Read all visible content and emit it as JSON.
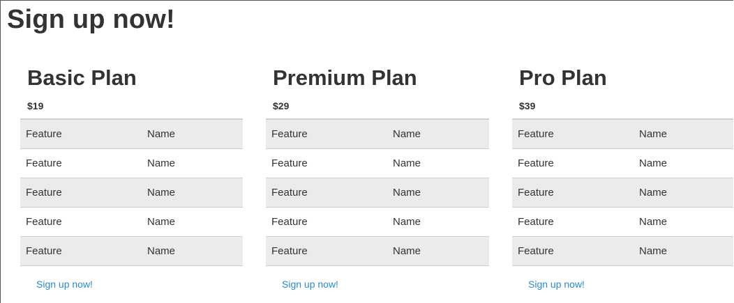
{
  "page": {
    "title": "Sign up now!"
  },
  "plans": [
    {
      "name": "Basic Plan",
      "price": "$19",
      "features": [
        {
          "label": "Feature",
          "value": "Name"
        },
        {
          "label": "Feature",
          "value": "Name"
        },
        {
          "label": "Feature",
          "value": "Name"
        },
        {
          "label": "Feature",
          "value": "Name"
        },
        {
          "label": "Feature",
          "value": "Name"
        }
      ],
      "cta": "Sign up now!"
    },
    {
      "name": "Premium Plan",
      "price": "$29",
      "features": [
        {
          "label": "Feature",
          "value": "Name"
        },
        {
          "label": "Feature",
          "value": "Name"
        },
        {
          "label": "Feature",
          "value": "Name"
        },
        {
          "label": "Feature",
          "value": "Name"
        },
        {
          "label": "Feature",
          "value": "Name"
        }
      ],
      "cta": "Sign up now!"
    },
    {
      "name": "Pro Plan",
      "price": "$39",
      "features": [
        {
          "label": "Feature",
          "value": "Name"
        },
        {
          "label": "Feature",
          "value": "Name"
        },
        {
          "label": "Feature",
          "value": "Name"
        },
        {
          "label": "Feature",
          "value": "Name"
        },
        {
          "label": "Feature",
          "value": "Name"
        }
      ],
      "cta": "Sign up now!"
    }
  ],
  "colors": {
    "link": "#2a8ad6",
    "row_stripe": "#ebebeb",
    "text": "#333333"
  }
}
